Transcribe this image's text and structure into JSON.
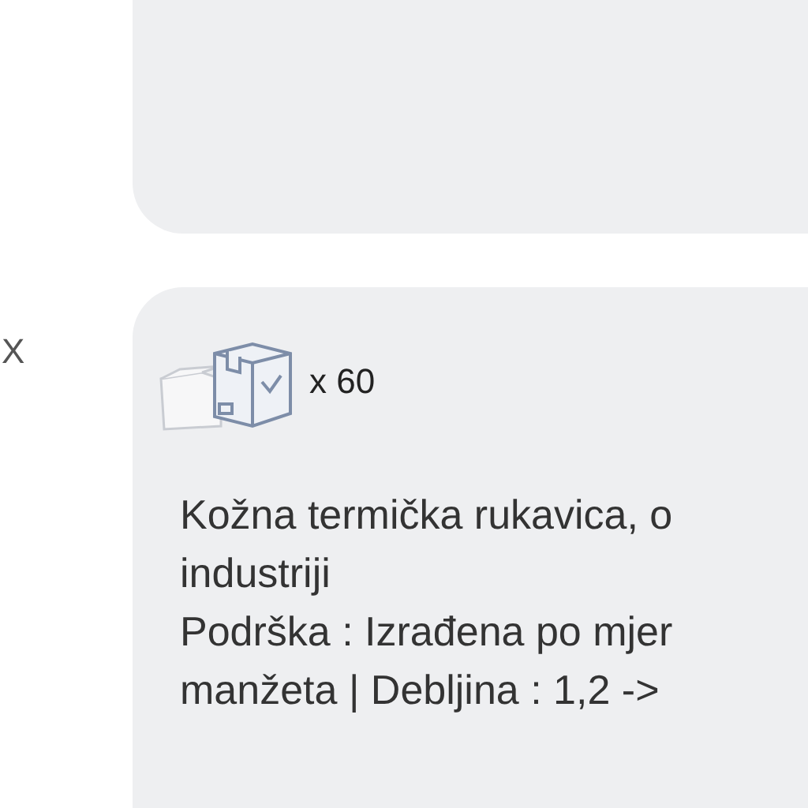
{
  "side_label": "X",
  "product_card": {
    "quantity": "x 60",
    "description_lines": [
      "Kožna termička rukavica, o",
      "industriji",
      "Podrška : Izrađena po mjer",
      "manžeta | Debljina : 1,2 ->"
    ]
  }
}
